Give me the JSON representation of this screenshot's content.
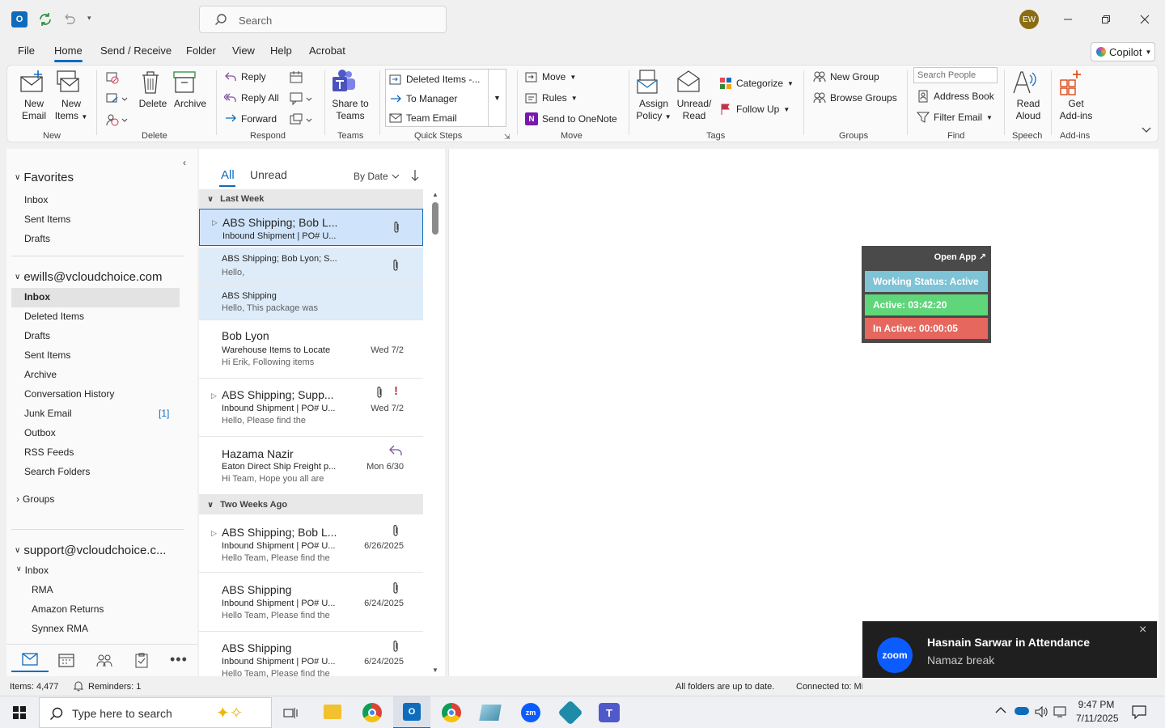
{
  "titlebar": {
    "search_placeholder": "Search",
    "avatar_initials": "EW"
  },
  "menu": {
    "tabs": [
      "File",
      "Home",
      "Send / Receive",
      "Folder",
      "View",
      "Help",
      "Acrobat"
    ],
    "copilot": "Copilot"
  },
  "ribbon": {
    "new_email": [
      "New",
      "Email"
    ],
    "new_items": [
      "New",
      "Items"
    ],
    "delete": "Delete",
    "archive": "Archive",
    "reply": "Reply",
    "reply_all": "Reply All",
    "forward": "Forward",
    "share_teams": [
      "Share to",
      "Teams"
    ],
    "quick_steps": [
      "Deleted Items -...",
      "To Manager",
      "Team Email"
    ],
    "move": "Move",
    "rules": "Rules",
    "send_onenote": "Send to OneNote",
    "assign_policy": [
      "Assign",
      "Policy"
    ],
    "unread_read": [
      "Unread/",
      "Read"
    ],
    "categorize": "Categorize",
    "follow_up": "Follow Up",
    "new_group": "New Group",
    "browse_groups": "Browse Groups",
    "search_people_placeholder": "Search People",
    "address_book": "Address Book",
    "filter_email": "Filter Email",
    "read_aloud": [
      "Read",
      "Aloud"
    ],
    "get_addins": [
      "Get",
      "Add-ins"
    ],
    "groups": [
      "New",
      "Delete",
      "Respond",
      "Teams",
      "Quick Steps",
      "Move",
      "Tags",
      "Groups",
      "Find",
      "Speech",
      "Add-ins"
    ]
  },
  "folders": {
    "favorites": "Favorites",
    "favorites_items": [
      "Inbox",
      "Sent Items",
      "Drafts"
    ],
    "account1": "ewills@vcloudchoice.com",
    "account1_items": [
      "Inbox",
      "Deleted Items",
      "Drafts",
      "Sent Items",
      "Archive",
      "Conversation History",
      "Junk Email",
      "Outbox",
      "RSS Feeds",
      "Search Folders"
    ],
    "junk_count": "[1]",
    "groups": "Groups",
    "account2": "support@vcloudchoice.c...",
    "account2_inbox": "Inbox",
    "account2_sub": [
      "RMA",
      "Amazon Returns",
      "Synnex RMA"
    ]
  },
  "list": {
    "filter_all": "All",
    "filter_unread": "Unread",
    "sort": "By Date",
    "group_last_week": "Last Week",
    "group_two_weeks": "Two Weeks Ago",
    "messages": [
      {
        "from": "ABS Shipping;  Bob L...",
        "subject": "Inbound Shipment | PO# U...",
        "preview": "",
        "date": ""
      },
      {
        "from": "ABS Shipping;  Bob Lyon;  S...",
        "subject": "",
        "preview": "Hello,",
        "date": ""
      },
      {
        "from": "ABS Shipping",
        "subject": "",
        "preview": "Hello,  This package was",
        "date": ""
      },
      {
        "from": "Bob Lyon",
        "subject": "Warehouse Items to Locate",
        "preview": "Hi Erik,  Following items",
        "date": "Wed 7/2"
      },
      {
        "from": "ABS Shipping;  Supp...",
        "subject": "Inbound Shipment | PO# U...",
        "preview": "Hello,  Please find the",
        "date": "Wed 7/2"
      },
      {
        "from": "Hazama Nazir",
        "subject": "Eaton Direct Ship Freight p...",
        "preview": "Hi Team,  Hope you all are",
        "date": "Mon 6/30"
      },
      {
        "from": "ABS Shipping;  Bob L...",
        "subject": "Inbound Shipment | PO# U...",
        "preview": "Hello Team,  Please find the",
        "date": "6/26/2025"
      },
      {
        "from": "ABS Shipping",
        "subject": "Inbound Shipment | PO# U...",
        "preview": "Hello Team,  Please find the",
        "date": "6/24/2025"
      },
      {
        "from": "ABS Shipping",
        "subject": "Inbound Shipment | PO# U...",
        "preview": "Hello Team,  Please find the",
        "date": "6/24/2025"
      }
    ]
  },
  "widget": {
    "open_app": "Open App ↗",
    "status": "Working Status: Active",
    "active": "Active: 03:42:20",
    "inactive": "In Active: 00:00:05",
    "colors": {
      "status": "#7fc3d6",
      "active": "#5fd67a",
      "inactive": "#e6675e"
    }
  },
  "toast": {
    "app": "zoom",
    "title": "Hasnain Sarwar in Attendance",
    "body": "Namaz break",
    "close": "×"
  },
  "status": {
    "items": "Items: 4,477",
    "reminders": "Reminders: 1",
    "sync": "All folders are up to date.",
    "connected": "Connected to: Microsoft Exchange"
  },
  "taskbar": {
    "search_placeholder": "Type here to search",
    "time": "9:47 PM",
    "date": "7/11/2025"
  }
}
